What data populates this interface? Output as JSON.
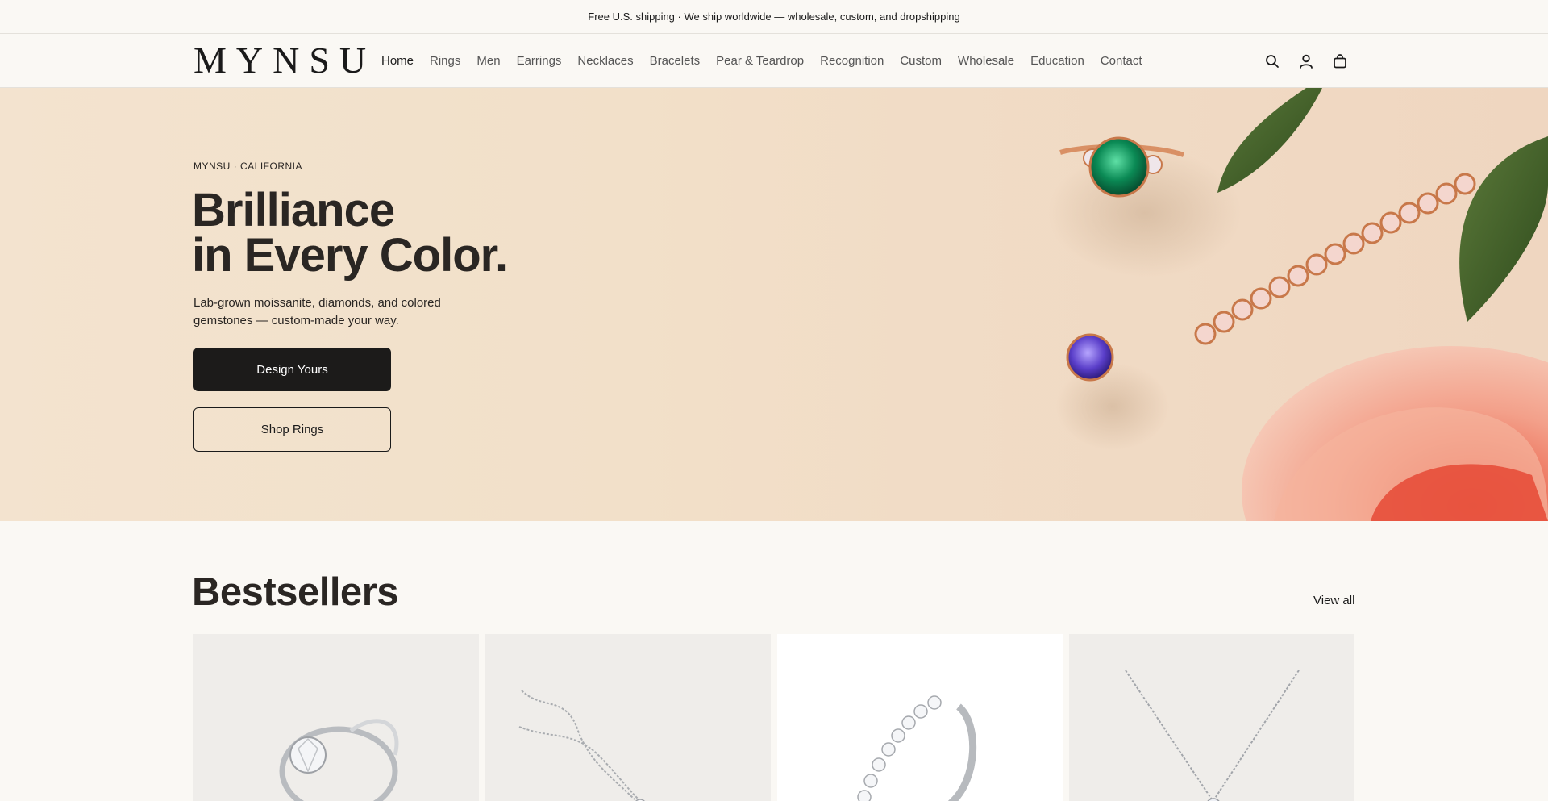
{
  "announcement": "Free U.S. shipping · We ship worldwide — wholesale, custom, and dropshipping",
  "header": {
    "logo": "MYNSU",
    "nav": [
      {
        "label": "Home",
        "active": true
      },
      {
        "label": "Rings"
      },
      {
        "label": "Men"
      },
      {
        "label": "Earrings"
      },
      {
        "label": "Necklaces"
      },
      {
        "label": "Bracelets"
      },
      {
        "label": "Pear & Teardrop"
      },
      {
        "label": "Recognition"
      },
      {
        "label": "Custom"
      },
      {
        "label": "Wholesale"
      },
      {
        "label": "Education"
      },
      {
        "label": "Contact"
      }
    ],
    "icons": [
      "search-icon",
      "account-icon",
      "cart-icon"
    ]
  },
  "hero": {
    "eyebrow": "MYNSU · CALIFORNIA",
    "headline_line1": "Brilliance",
    "headline_line2": "in Every Color.",
    "subcopy": "Lab-grown moissanite, diamonds, and colored gemstones — custom-made your way.",
    "primary_cta": "Design Yours",
    "secondary_cta": "Shop Rings"
  },
  "bestsellers": {
    "title": "Bestsellers",
    "view_all": "View all",
    "products": [
      {
        "image": "solitaire-ring-image"
      },
      {
        "image": "pendant-necklace-image"
      },
      {
        "image": "eternity-band-image"
      },
      {
        "image": "solitaire-pendant-image"
      }
    ]
  },
  "colors": {
    "background": "#faf8f4",
    "hero_bg": "#f2e0c9",
    "primary_button": "#1c1b1a",
    "text": "#2a2623"
  }
}
